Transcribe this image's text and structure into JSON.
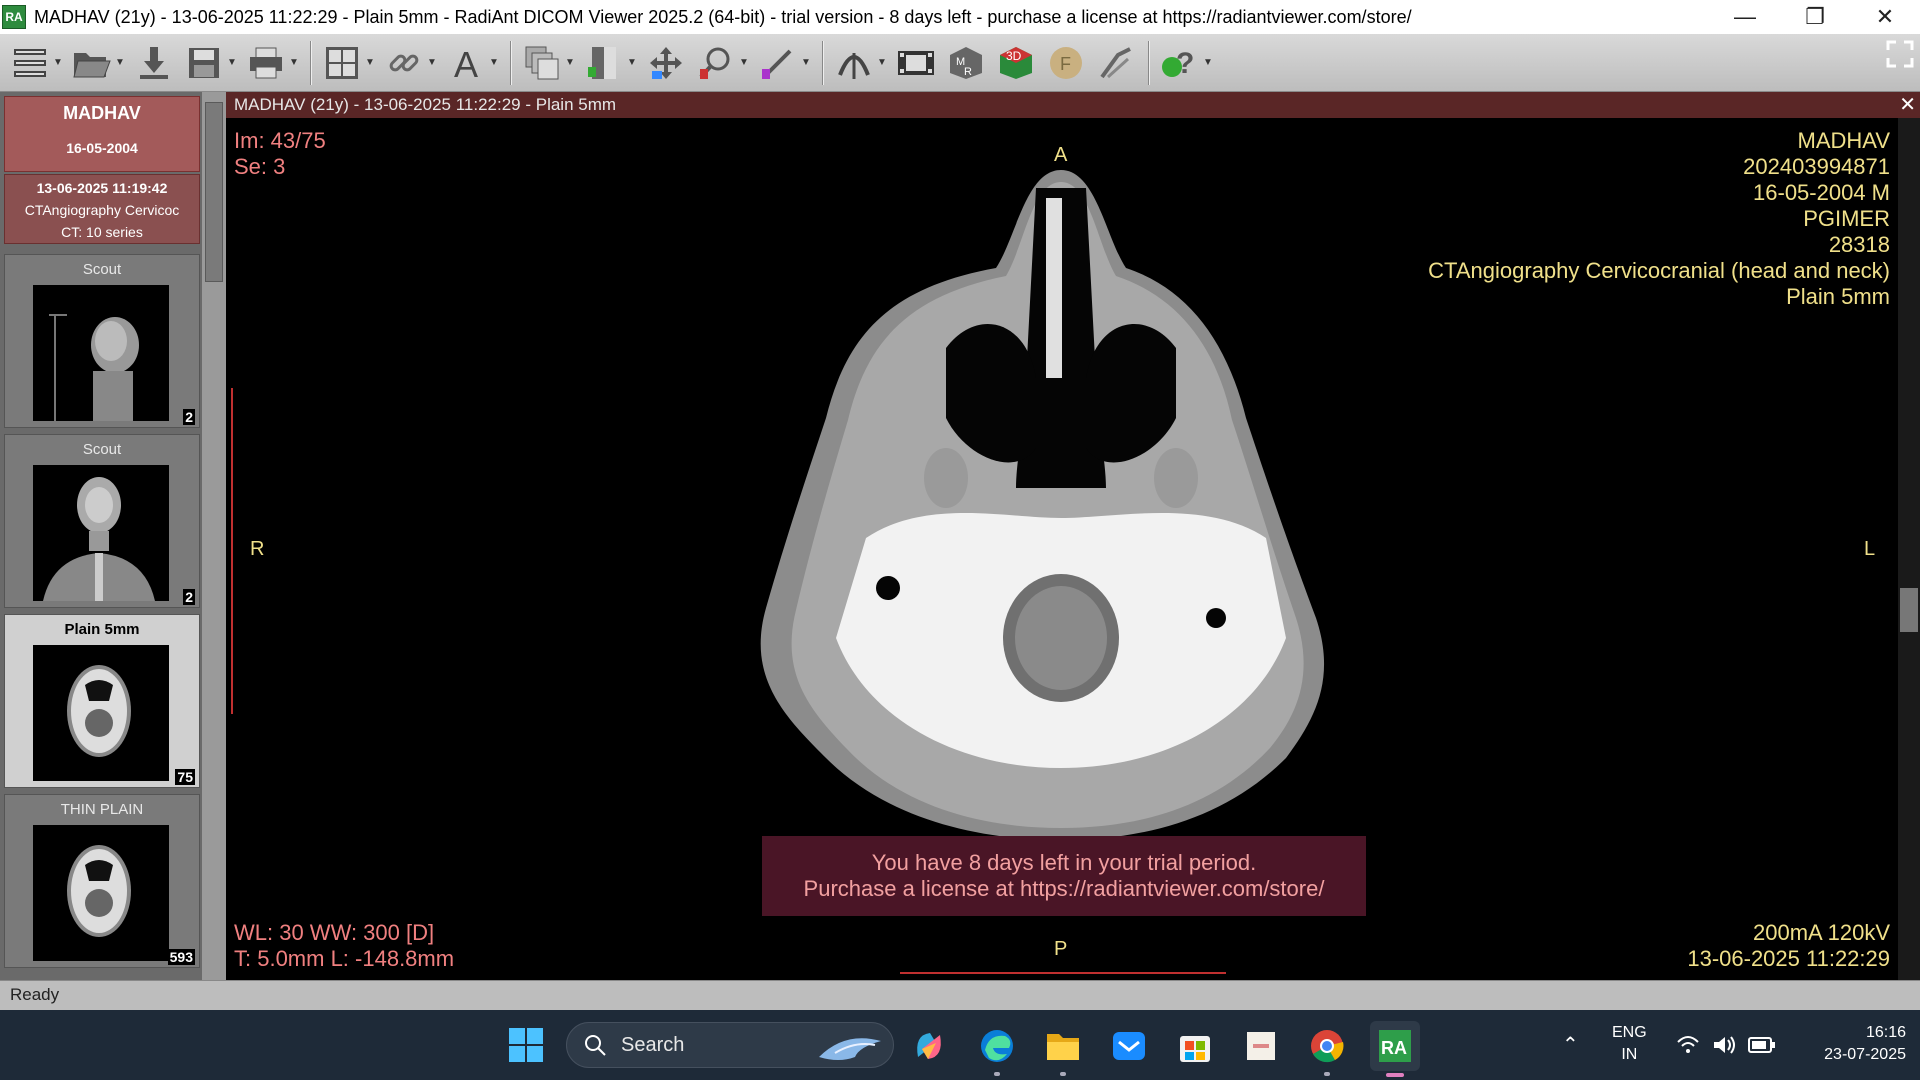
{
  "window": {
    "title": "MADHAV (21y) - 13-06-2025 11:22:29 - Plain 5mm - RadiAnt DICOM Viewer 2025.2 (64-bit) - trial version - 8 days left - purchase a license at https://radiantviewer.com/store/",
    "app_icon_text": "RA",
    "minimize": "—",
    "restore": "❐",
    "close": "✕"
  },
  "patient_panel": {
    "name": "MADHAV",
    "dob": "16-05-2004",
    "study": {
      "datetime": "13-06-2025 11:19:42",
      "description": "CTAngiography Cervicoc",
      "series_count": "CT: 10 series"
    },
    "series": [
      {
        "title": "Scout",
        "count": "2"
      },
      {
        "title": "Scout",
        "count": "2"
      },
      {
        "title": "Plain 5mm",
        "count": "75"
      },
      {
        "title": "THIN PLAIN",
        "count": "593"
      }
    ]
  },
  "viewer": {
    "header": "MADHAV  (21y) - 13-06-2025 11:22:29 - Plain 5mm",
    "top_left": [
      "Im: 43/75",
      "Se: 3"
    ],
    "top_right": [
      "MADHAV",
      "202403994871",
      "16-05-2004 M",
      "PGIMER",
      "28318",
      "CTAngiography Cervicocranial (head and neck)",
      "Plain 5mm"
    ],
    "bottom_left": [
      "WL: 30 WW: 300 [D]",
      "T: 5.0mm L: -148.8mm"
    ],
    "bottom_right": [
      "200mA 120kV",
      "13-06-2025 11:22:29"
    ],
    "orientation": {
      "top": "A",
      "bottom": "P",
      "left": "R",
      "right": "L"
    },
    "trial_message": [
      "You have 8 days left in your trial period.",
      "Purchase a license at https://radiantviewer.com/store/"
    ]
  },
  "status": "Ready",
  "taskbar": {
    "search_label": "Search",
    "language": [
      "ENG",
      "IN"
    ],
    "time": "16:16",
    "date": "23-07-2025"
  }
}
